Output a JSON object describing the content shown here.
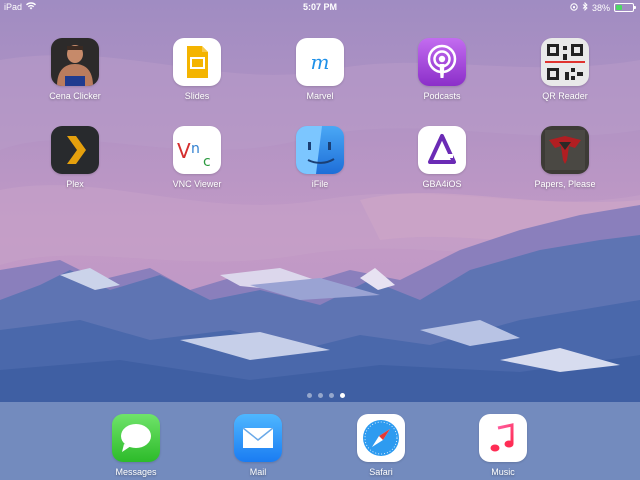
{
  "status_bar": {
    "device": "iPad",
    "time": "5:07 PM",
    "battery_percent": "38%",
    "battery_level": 0.38,
    "icons": [
      "wifi-icon",
      "rotation-lock-icon",
      "bluetooth-icon",
      "battery-icon"
    ]
  },
  "apps": [
    {
      "label": "Cena Clicker",
      "icon": "cena-clicker-icon"
    },
    {
      "label": "Slides",
      "icon": "slides-icon"
    },
    {
      "label": "Marvel",
      "icon": "marvel-icon"
    },
    {
      "label": "Podcasts",
      "icon": "podcasts-icon"
    },
    {
      "label": "QR Reader",
      "icon": "qr-code-icon"
    },
    {
      "label": "Plex",
      "icon": "plex-chevron-icon"
    },
    {
      "label": "VNC Viewer",
      "icon": "vnc-icon"
    },
    {
      "label": "iFile",
      "icon": "finder-face-icon"
    },
    {
      "label": "GBA4iOS",
      "icon": "gba4ios-icon"
    },
    {
      "label": "Papers, Please",
      "icon": "papers-please-eagle-icon"
    }
  ],
  "dock": [
    {
      "label": "Messages",
      "icon": "messages-bubble-icon"
    },
    {
      "label": "Mail",
      "icon": "mail-envelope-icon"
    },
    {
      "label": "Safari",
      "icon": "safari-compass-icon"
    },
    {
      "label": "Music",
      "icon": "music-note-icon"
    }
  ],
  "page_indicator": {
    "pages": 4,
    "current": 4
  },
  "colors": {
    "sky_top": "#a98fc3",
    "sky_bottom": "#c49bc4",
    "mountain_dark": "#4e6aab",
    "mountain_light": "#cbd3ea",
    "battery_green": "#4cd964"
  }
}
